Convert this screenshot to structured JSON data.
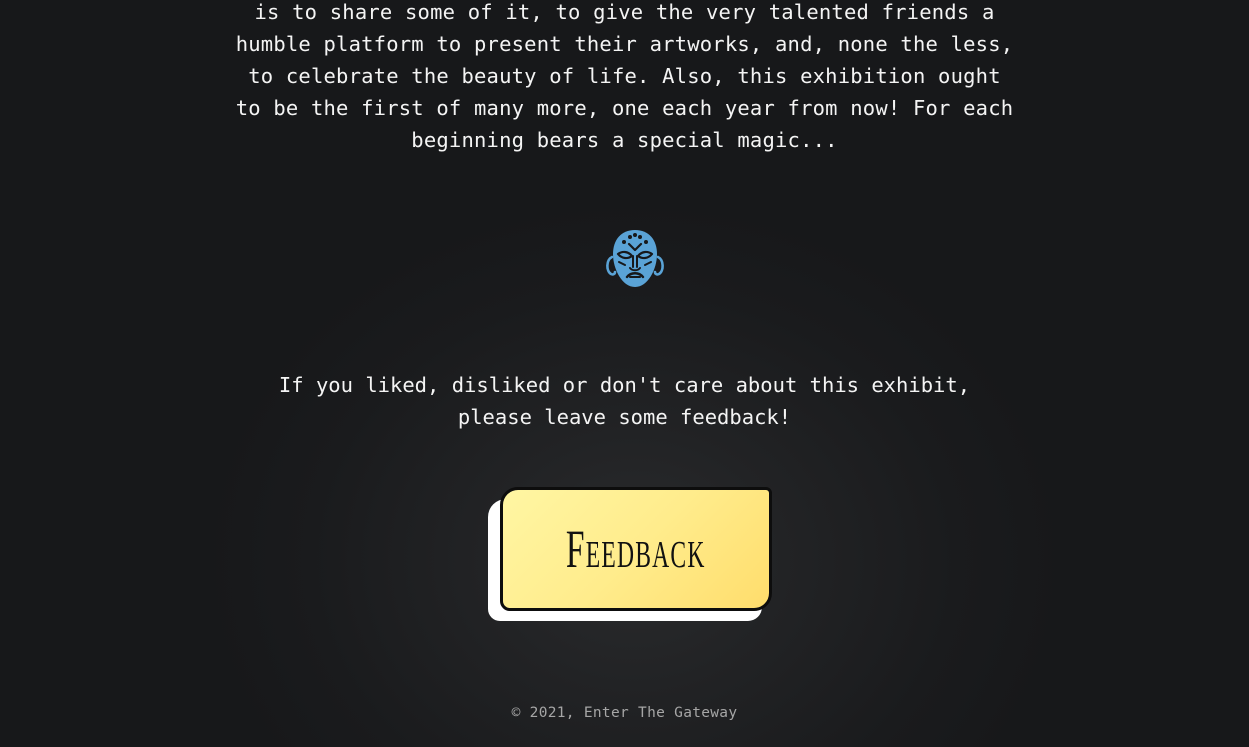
{
  "intro": {
    "lines": [
      "is to share some of it, to give the very talented friends a",
      "humble platform to present their artworks, and, none the less,",
      "to celebrate the beauty of life. Also, this exhibition ought",
      "to be the first of many more, one each year from now! For each",
      "beginning bears a special magic..."
    ]
  },
  "decoration": {
    "icon": "tribal-mask-icon",
    "color": "#5aa3d6"
  },
  "feedback": {
    "prompt_lines": [
      "If you liked, disliked or don't care about this exhibit,",
      "please leave some feedback!"
    ],
    "button_label": "Feedback",
    "button_color": "#ffe57a"
  },
  "footer": {
    "text": "© 2021, Enter The Gateway"
  },
  "colors": {
    "background": "#17181a",
    "text": "#f4f4f4",
    "footer_text": "#a6a6a6"
  }
}
